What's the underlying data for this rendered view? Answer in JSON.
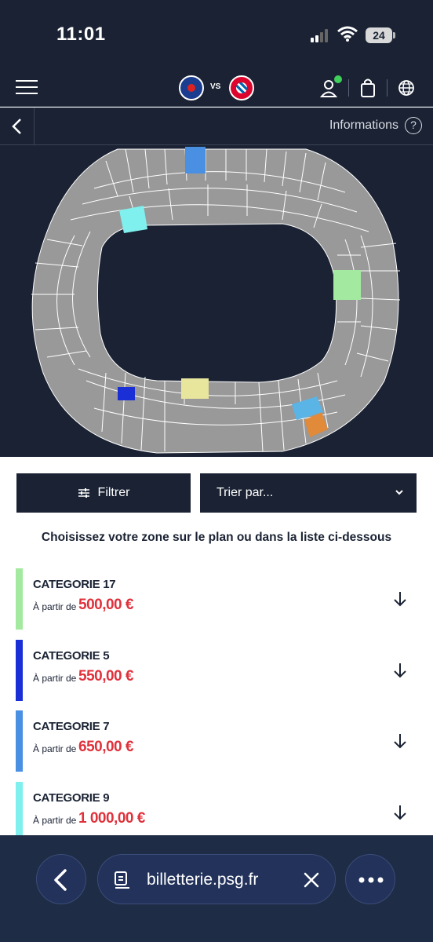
{
  "status_bar": {
    "time": "11:01",
    "battery": "24"
  },
  "header": {
    "vs_label": "VS"
  },
  "sub_nav": {
    "info_label": "Informations",
    "info_icon_glyph": "?"
  },
  "filters": {
    "filter_label": "Filtrer",
    "sort_label": "Trier par..."
  },
  "instructions": "Choisissez votre zone sur le plan ou dans la liste ci-dessous",
  "categories": [
    {
      "name": "CATEGORIE 17",
      "from_label": "À partir de",
      "price": "500,00 €",
      "color": "#a3eaa0"
    },
    {
      "name": "CATEGORIE 5",
      "from_label": "À partir de",
      "price": "550,00 €",
      "color": "#1a2fd6"
    },
    {
      "name": "CATEGORIE 7",
      "from_label": "À partir de",
      "price": "650,00 €",
      "color": "#4a90e2"
    },
    {
      "name": "CATEGORIE 9",
      "from_label": "À partir de",
      "price": "1 000,00 €",
      "color": "#7ff0ee"
    }
  ],
  "browser": {
    "url": "billetterie.psg.fr"
  },
  "colors": {
    "navy": "#1a2233",
    "price_red": "#e0313b",
    "seat_gray": "#999999",
    "zone_cat17": "#a3eaa0",
    "zone_cat5": "#1a2fd6",
    "zone_cat7": "#4a90e2",
    "zone_cat9": "#7ff0ee",
    "zone_yellow": "#e8e59c",
    "zone_lightblue": "#5ab4e6",
    "zone_orange": "#e08a3a"
  },
  "icons": [
    "hamburger-icon",
    "user-icon",
    "bag-icon",
    "globe-icon",
    "chevron-left-icon",
    "question-icon",
    "filter-sliders-icon",
    "chevron-down-icon",
    "arrow-down-icon",
    "page-icon",
    "close-icon",
    "more-icon"
  ]
}
